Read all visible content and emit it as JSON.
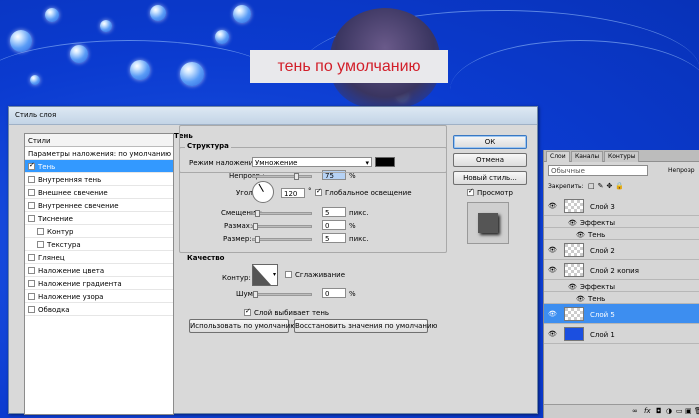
{
  "caption": "тень по умолчанию",
  "dialog": {
    "title": "Стиль слоя",
    "styles_header": "Стили",
    "blend_options": "Параметры наложения: по умолчанию",
    "styles": [
      {
        "label": "Тень",
        "checked": true,
        "selected": true,
        "indent": false
      },
      {
        "label": "Внутренняя тень",
        "checked": false,
        "selected": false,
        "indent": false
      },
      {
        "label": "Внешнее свечение",
        "checked": false,
        "selected": false,
        "indent": false
      },
      {
        "label": "Внутреннее свечение",
        "checked": false,
        "selected": false,
        "indent": false
      },
      {
        "label": "Тиснение",
        "checked": false,
        "selected": false,
        "indent": false
      },
      {
        "label": "Контур",
        "checked": false,
        "selected": false,
        "indent": true
      },
      {
        "label": "Текстура",
        "checked": false,
        "selected": false,
        "indent": true
      },
      {
        "label": "Глянец",
        "checked": false,
        "selected": false,
        "indent": false
      },
      {
        "label": "Наложение цвета",
        "checked": false,
        "selected": false,
        "indent": false
      },
      {
        "label": "Наложение градиента",
        "checked": false,
        "selected": false,
        "indent": false
      },
      {
        "label": "Наложение узора",
        "checked": false,
        "selected": false,
        "indent": false
      },
      {
        "label": "Обводка",
        "checked": false,
        "selected": false,
        "indent": false
      }
    ],
    "section_title": "Тень",
    "structure": {
      "title": "Структура",
      "blend_mode_label": "Режим наложения:",
      "blend_mode_value": "Умножение",
      "shadow_color": "#000000",
      "opacity_label": "Непрозр.:",
      "opacity_value": "75",
      "opacity_fraction": 0.75,
      "percent": "%",
      "angle_label": "Угол:",
      "angle_value": "120",
      "degree": "°",
      "global_light_label": "Глобальное освещение",
      "distance_label": "Смещение:",
      "distance_value": "5",
      "size_label": "Размах:",
      "size_value": "0",
      "spread_label": "Размер:",
      "spread_value": "5",
      "px_unit": "пикс."
    },
    "quality": {
      "title": "Качество",
      "contour_label": "Контур:",
      "antialias_label": "Сглаживание",
      "noise_label": "Шум:",
      "noise_value": "0",
      "percent": "%"
    },
    "knockout_label": "Слой выбивает тень",
    "make_default": "Использовать по умолчанию",
    "reset_default": "Восстановить значения по умолчанию",
    "ok": "ОК",
    "cancel": "Отмена",
    "new_style": "Новый стиль...",
    "preview": "Просмотр"
  },
  "layers": {
    "tabs": [
      "Слои",
      "Каналы",
      "Контуры"
    ],
    "blend_mode": "Обычные",
    "opacity_label": "Непрозр",
    "lock_label": "Закрепить:",
    "rows": [
      {
        "name": "Слой 3",
        "kind": "layer",
        "selected": false
      },
      {
        "name": "Эффекты",
        "kind": "effects",
        "selected": false
      },
      {
        "name": "Тень",
        "kind": "effect",
        "selected": false
      },
      {
        "name": "Слой 2",
        "kind": "layer",
        "selected": false
      },
      {
        "name": "Слой 2 копия",
        "kind": "layer",
        "selected": false
      },
      {
        "name": "Эффекты",
        "kind": "effects",
        "selected": false
      },
      {
        "name": "Тень",
        "kind": "effect",
        "selected": false
      },
      {
        "name": "Слой 5",
        "kind": "layer",
        "selected": true
      },
      {
        "name": "Слой 1",
        "kind": "layer-blue",
        "selected": false
      }
    ],
    "footer_icons": [
      "link-icon",
      "fx-icon",
      "mask-icon",
      "adjustment-icon",
      "group-icon",
      "new-layer-icon",
      "trash-icon"
    ]
  }
}
